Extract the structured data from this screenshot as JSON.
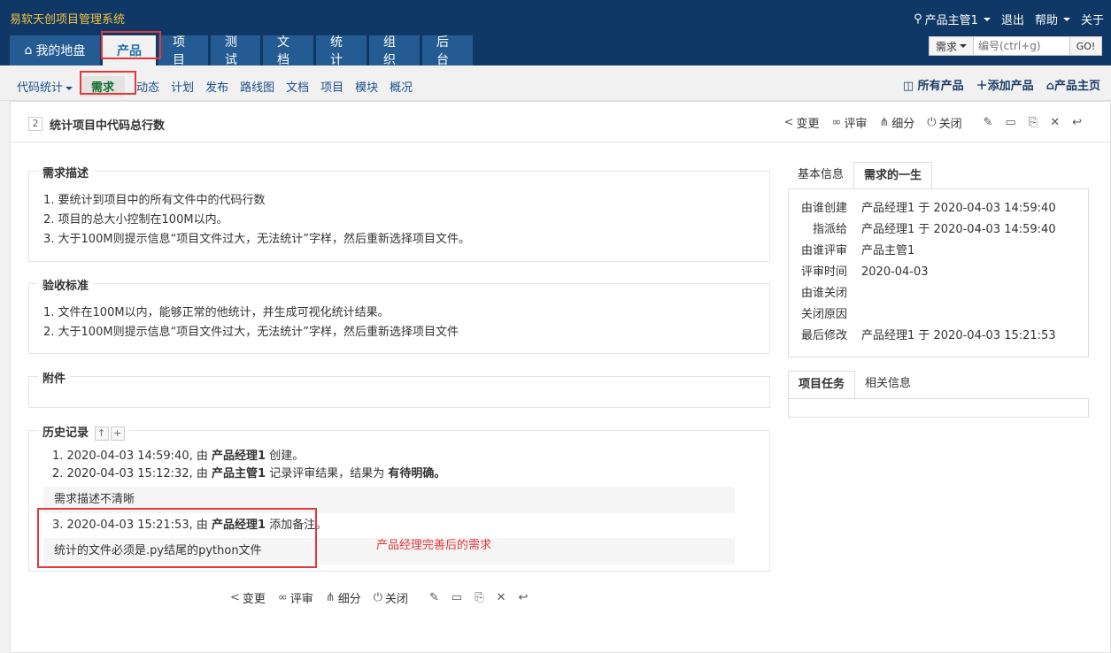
{
  "app_title": "易软天创项目管理系统",
  "user": {
    "name": "产品主管1",
    "logout": "退出",
    "help": "帮助",
    "about": "关于"
  },
  "nav_tabs": [
    "我的地盘",
    "产品",
    "项目",
    "测试",
    "文档",
    "统计",
    "组织",
    "后台"
  ],
  "search": {
    "type": "需求",
    "placeholder": "编号(ctrl+g)",
    "go": "GO!"
  },
  "subnav": {
    "items": [
      "代码统计",
      "需求",
      "动态",
      "计划",
      "发布",
      "路线图",
      "文档",
      "项目",
      "模块",
      "概况"
    ],
    "right": [
      "所有产品",
      "添加产品",
      "产品主页"
    ]
  },
  "story": {
    "id": "2",
    "title": "统计项目中代码总行数"
  },
  "actions": {
    "change": "变更",
    "review": "评审",
    "split": "细分",
    "close": "关闭"
  },
  "description": {
    "legend": "需求描述",
    "lines": [
      "1. 要统计到项目中的所有文件中的代码行数",
      "2. 项目的总大小控制在100M以内。",
      "3. 大于100M则提示信息“项目文件过大，无法统计”字样，然后重新选择项目文件。"
    ]
  },
  "acceptance": {
    "legend": "验收标准",
    "lines": [
      "1. 文件在100M以内，能够正常的他统计，并生成可视化统计结果。",
      "2. 大于100M则提示信息“项目文件过大，无法统计”字样，然后重新选择项目文件"
    ]
  },
  "attachments": {
    "legend": "附件"
  },
  "history": {
    "legend": "历史记录",
    "entries": [
      {
        "prefix": "1. 2020-04-03 14:59:40, 由 ",
        "actor": "产品经理1",
        "action": " 创建。",
        "result": "",
        "note": ""
      },
      {
        "prefix": "2. 2020-04-03 15:12:32, 由 ",
        "actor": "产品主管1",
        "action": " 记录评审结果，结果为 ",
        "result": "有待明确。",
        "note": "需求描述不清晰"
      },
      {
        "prefix": "3. 2020-04-03 15:21:53, 由 ",
        "actor": "产品经理1",
        "action": " 添加备注。",
        "result": "",
        "note": "统计的文件必须是.py结尾的python文件"
      }
    ],
    "annotation": "产品经理完善后的需求"
  },
  "side": {
    "tabs": [
      "基本信息",
      "需求的一生"
    ],
    "life": [
      {
        "label": "由谁创建",
        "value": "产品经理1 于 2020-04-03 14:59:40"
      },
      {
        "label": "指派给",
        "value": "产品经理1 于 2020-04-03 14:59:40"
      },
      {
        "label": "由谁评审",
        "value": "产品主管1"
      },
      {
        "label": "评审时间",
        "value": "2020-04-03"
      },
      {
        "label": "由谁关闭",
        "value": ""
      },
      {
        "label": "关闭原因",
        "value": ""
      },
      {
        "label": "最后修改",
        "value": "产品经理1 于 2020-04-03 15:21:53"
      }
    ],
    "tabs2": [
      "项目任务",
      "相关信息"
    ]
  }
}
